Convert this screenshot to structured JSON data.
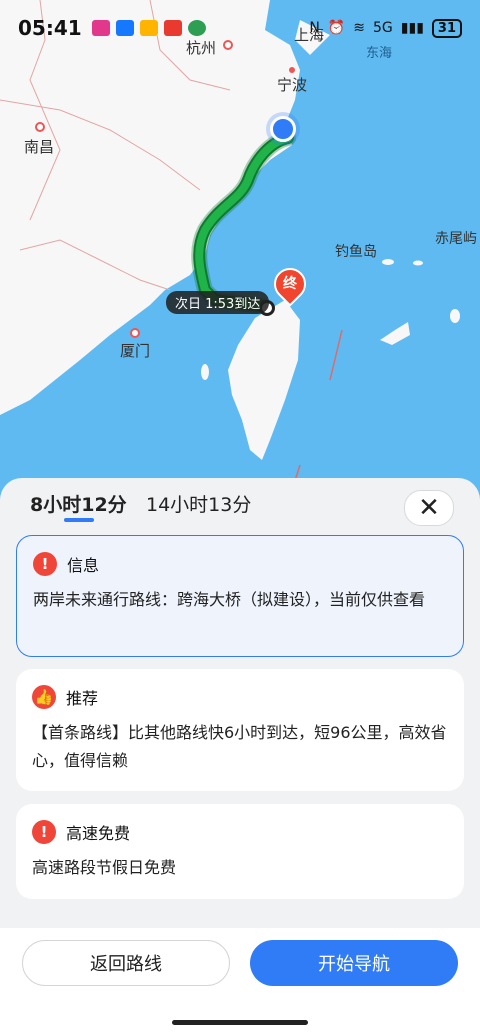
{
  "status_bar": {
    "time": "05:41",
    "network": "5G",
    "battery": "31",
    "colors": {
      "app1": "#e2388c",
      "app2": "#1677ff",
      "app3": "#ffb400",
      "app4": "#e83a2f",
      "app5": "#2e9e52"
    }
  },
  "map": {
    "labels": {
      "shanghai": "上海",
      "hangzhou": "杭州",
      "ningbo": "宁波",
      "east_sea": "东海",
      "nanchang": "南昌",
      "diaoyu": "钓鱼岛",
      "chiwei": "赤尾屿",
      "xiamen": "厦门"
    },
    "eta_tag": "次日 1:53到达",
    "end_marker": "终",
    "colors": {
      "sea": "#5fbaf2",
      "land": "#f7f7f7",
      "route": "#1fb34a",
      "route_border": "#0f7a2e"
    }
  },
  "sheet": {
    "tabs": [
      {
        "label": "8小时12分",
        "active": true
      },
      {
        "label": "14小时13分",
        "active": false
      }
    ],
    "close_icon": "close-icon",
    "cards": [
      {
        "icon": "warning-icon",
        "title": "信息",
        "text": "两岸未来通行路线：跨海大桥（拟建设），当前仅供查看"
      },
      {
        "icon": "thumbs-up-icon",
        "title": "推荐",
        "text": "【首条路线】比其他路线快6小时到达，短96公里，高效省心，值得信赖"
      },
      {
        "icon": "warning-icon",
        "title": "高速免费",
        "text": "高速路段节假日免费"
      }
    ],
    "buttons": {
      "back": "返回路线",
      "start": "开始导航"
    }
  }
}
